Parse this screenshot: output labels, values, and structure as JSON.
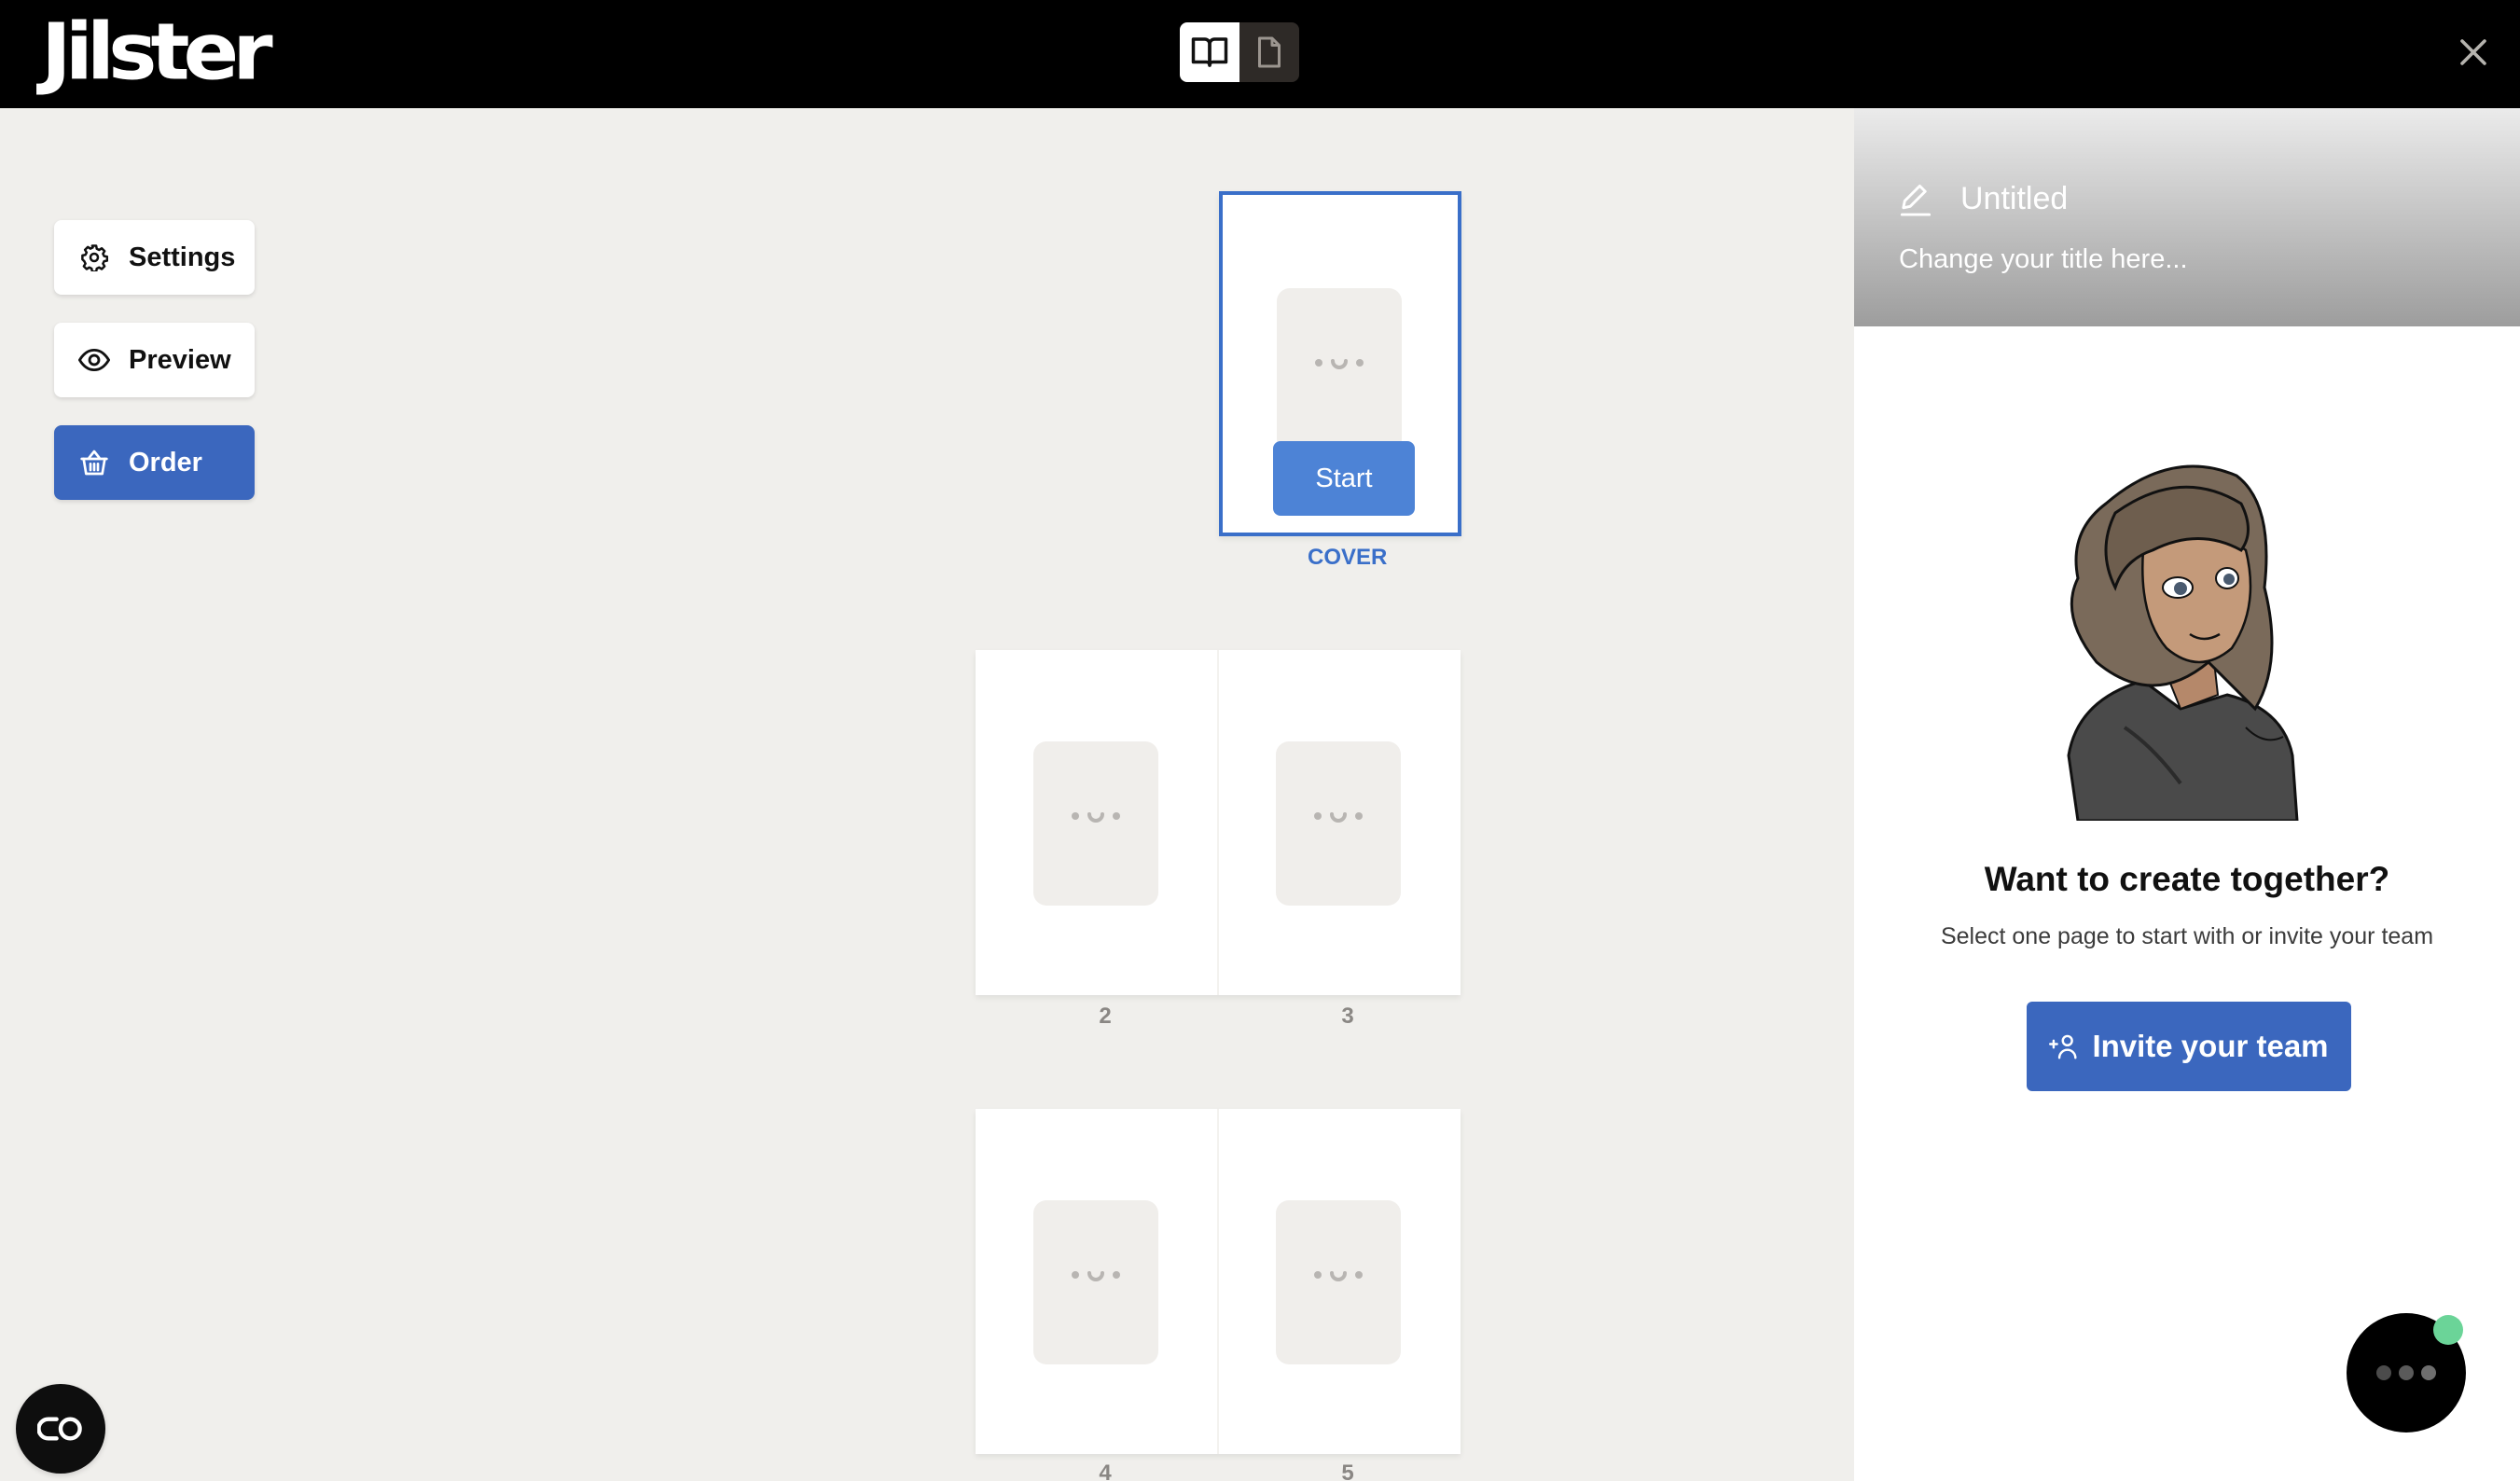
{
  "header": {
    "logo_text": "Jilster",
    "view_toggle": {
      "options": [
        {
          "id": "spread",
          "icon": "open-book-icon",
          "active": true
        },
        {
          "id": "single",
          "icon": "single-page-icon",
          "active": false
        }
      ]
    },
    "close_icon": "close-icon"
  },
  "sidebar": {
    "buttons": [
      {
        "label": "Settings",
        "icon": "gear-icon"
      },
      {
        "label": "Preview",
        "icon": "eye-icon"
      },
      {
        "label": "Order",
        "icon": "basket-icon",
        "primary": true
      }
    ]
  },
  "pages": {
    "cover": {
      "label": "COVER",
      "start_button": "Start",
      "selected": true
    },
    "spreads": [
      {
        "left": "2",
        "right": "3"
      },
      {
        "left": "4",
        "right": "5"
      }
    ]
  },
  "right_panel": {
    "title": "Untitled",
    "title_hint": "Change your title here...",
    "heading": "Want to create together?",
    "subtitle": "Select one page to start with or invite your team",
    "invite_button": "Invite your team"
  },
  "floating": {
    "chat_icon": "chat-dots-icon",
    "status_color": "#6bd498",
    "link_icon": "link-toggle-icon"
  },
  "colors": {
    "primary": "#3b67be",
    "selection": "#3a6fc9",
    "start_button": "#4d83d6",
    "canvas_bg": "#f0efec"
  }
}
